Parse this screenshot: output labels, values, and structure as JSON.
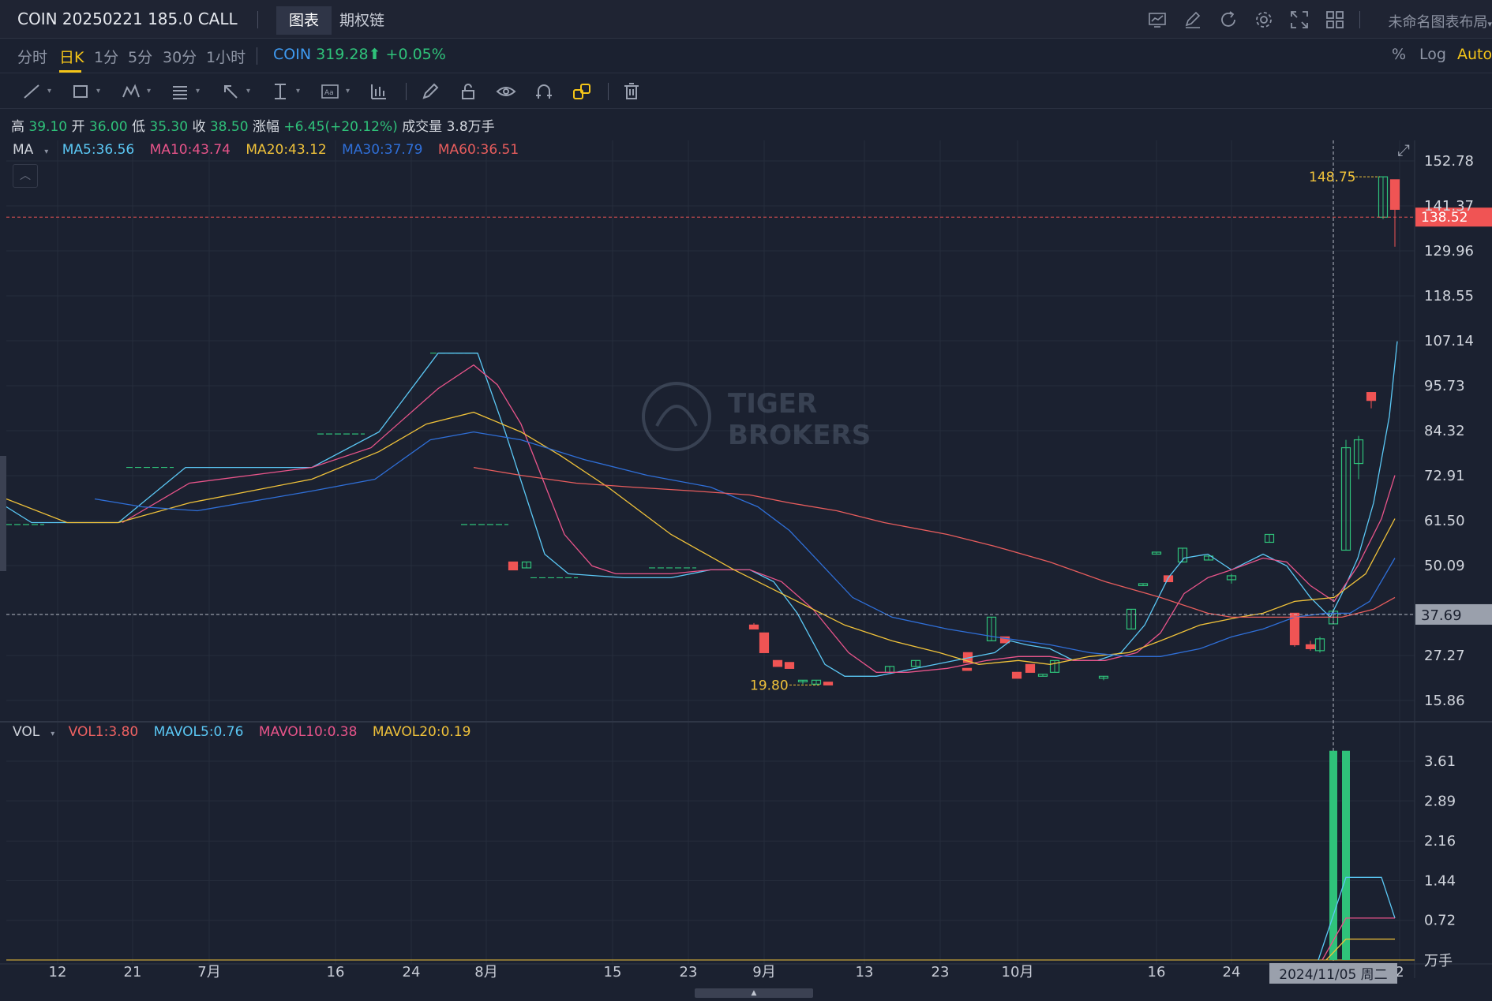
{
  "header": {
    "title": "COIN 20250221 185.0 CALL",
    "tabs": [
      {
        "label": "图表",
        "active": true
      },
      {
        "label": "期权链",
        "active": false
      }
    ],
    "layout_name": "未命名图表布局",
    "icons": [
      "chart-icon",
      "edit-icon",
      "refresh-icon",
      "settings-icon",
      "fullscreen-icon",
      "grid-layout-icon"
    ]
  },
  "periods": [
    "分时",
    "日K",
    "1分",
    "5分",
    "30分",
    "1小时"
  ],
  "active_period": "日K",
  "underlying": {
    "symbol": "COIN",
    "price": "319.28",
    "arrow": "⬆",
    "change": "+0.05%"
  },
  "scale_options": [
    "%",
    "Log",
    "Auto"
  ],
  "toolbar_tools": [
    "trend-line",
    "rectangle",
    "pattern",
    "fib",
    "arrow",
    "measure",
    "text",
    "indicator",
    "pencil",
    "lock",
    "eye",
    "magnet",
    "link",
    "trash"
  ],
  "ohlc": {
    "high_label": "高",
    "high": "39.10",
    "open_label": "开",
    "open": "36.00",
    "low_label": "低",
    "low": "35.30",
    "close_label": "收",
    "close": "38.50",
    "change_label": "涨幅",
    "change": "+6.45(+20.12%)",
    "volume_label": "成交量",
    "volume": "3.8万手"
  },
  "ma_legend": {
    "label": "MA",
    "items": [
      {
        "text": "MA5:36.56",
        "color": "#5bc8f5"
      },
      {
        "text": "MA10:43.74",
        "color": "#e8548a"
      },
      {
        "text": "MA20:43.12",
        "color": "#f0c23a"
      },
      {
        "text": "MA30:37.79",
        "color": "#2f6fd8"
      },
      {
        "text": "MA60:36.51",
        "color": "#e85d5d"
      }
    ]
  },
  "vol_legend": {
    "label": "VOL",
    "items": [
      {
        "text": "VOL1:3.80",
        "color": "#f06262"
      },
      {
        "text": "MAVOL5:0.76",
        "color": "#5bc8f5"
      },
      {
        "text": "MAVOL10:0.38",
        "color": "#e8548a"
      },
      {
        "text": "MAVOL20:0.19",
        "color": "#f0c23a"
      }
    ]
  },
  "colors": {
    "up": "#f05454",
    "down": "#2fc27a",
    "grid": "#2a3142",
    "bg": "#1b2130"
  },
  "chart_data": {
    "type": "candlestick",
    "price_axis": [
      "152.78",
      "141.37",
      "129.96",
      "118.55",
      "107.14",
      "95.73",
      "84.32",
      "72.91",
      "61.50",
      "50.09",
      "37.69",
      "27.27",
      "15.86"
    ],
    "price_ylim": [
      15.86,
      152.78
    ],
    "current_price_tag": "138.52",
    "crosshair_price_tag": "37.69",
    "max_label": "148.75",
    "min_label": "19.80",
    "x_ticks": [
      "12",
      "21",
      "7月",
      "16",
      "24",
      "8月",
      "15",
      "23",
      "9月",
      "13",
      "23",
      "10月",
      "16",
      "24",
      "2"
    ],
    "crosshair_date": "2024/11/05 周二",
    "candles": [
      {
        "o": 60.5,
        "c": 60.5,
        "h": 60.5,
        "l": 60.5
      },
      {
        "o": 75.0,
        "c": 75.0,
        "h": 75.0,
        "l": 75.0
      },
      {
        "o": 83.5,
        "c": 83.5,
        "h": 83.5,
        "l": 83.5
      },
      {
        "o": 104.0,
        "c": 104.0,
        "h": 104.0,
        "l": 104.0
      },
      {
        "o": 60.5,
        "c": 60.5,
        "h": 60.5,
        "l": 60.5
      },
      {
        "o": 51.0,
        "c": 49.0,
        "h": 51.0,
        "l": 49.0
      },
      {
        "o": 49.5,
        "c": 51.0,
        "h": 51.0,
        "l": 49.5
      },
      {
        "o": 47.0,
        "c": 47.0,
        "h": 47.0,
        "l": 47.0
      },
      {
        "o": 49.5,
        "c": 49.5,
        "h": 49.5,
        "l": 49.5
      },
      {
        "o": 35.0,
        "c": 34.0,
        "h": 35.5,
        "l": 34.0
      },
      {
        "o": 33.0,
        "c": 28.0,
        "h": 33.0,
        "l": 28.0
      },
      {
        "o": 26.0,
        "c": 24.5,
        "h": 26.0,
        "l": 24.5
      },
      {
        "o": 25.5,
        "c": 24.0,
        "h": 25.5,
        "l": 24.0
      },
      {
        "o": 21.0,
        "c": 21.0,
        "h": 21.0,
        "l": 20.0
      },
      {
        "o": 20.0,
        "c": 21.0,
        "h": 21.0,
        "l": 19.8
      },
      {
        "o": 20.5,
        "c": 19.8,
        "h": 20.5,
        "l": 19.8
      },
      {
        "o": 23.0,
        "c": 24.5,
        "h": 24.5,
        "l": 23.0
      },
      {
        "o": 24.5,
        "c": 26.0,
        "h": 26.0,
        "l": 24.5
      },
      {
        "o": 28.0,
        "c": 25.5,
        "h": 28.0,
        "l": 25.5
      },
      {
        "o": 24.0,
        "c": 23.5,
        "h": 24.0,
        "l": 23.5
      },
      {
        "o": 31.0,
        "c": 37.0,
        "h": 37.0,
        "l": 31.0
      },
      {
        "o": 32.0,
        "c": 30.5,
        "h": 32.0,
        "l": 30.5
      },
      {
        "o": 23.0,
        "c": 21.5,
        "h": 23.0,
        "l": 21.5
      },
      {
        "o": 25.0,
        "c": 23.0,
        "h": 25.0,
        "l": 23.0
      },
      {
        "o": 22.0,
        "c": 22.5,
        "h": 22.5,
        "l": 22.0
      },
      {
        "o": 23.0,
        "c": 26.0,
        "h": 26.0,
        "l": 23.0
      },
      {
        "o": 21.5,
        "c": 22.0,
        "h": 22.0,
        "l": 21.0
      },
      {
        "o": 34.0,
        "c": 39.0,
        "h": 39.0,
        "l": 34.0
      },
      {
        "o": 45.0,
        "c": 45.5,
        "h": 45.5,
        "l": 45.0
      },
      {
        "o": 53.0,
        "c": 53.5,
        "h": 53.5,
        "l": 53.0
      },
      {
        "o": 47.5,
        "c": 46.0,
        "h": 47.5,
        "l": 46.0
      },
      {
        "o": 51.0,
        "c": 54.5,
        "h": 54.5,
        "l": 51.0
      },
      {
        "o": 51.5,
        "c": 52.5,
        "h": 52.5,
        "l": 51.5
      },
      {
        "o": 46.5,
        "c": 47.5,
        "h": 48.0,
        "l": 45.5
      },
      {
        "o": 56.0,
        "c": 58.0,
        "h": 58.0,
        "l": 56.0
      },
      {
        "o": 38.0,
        "c": 30.0,
        "h": 38.0,
        "l": 29.5
      },
      {
        "o": 30.0,
        "c": 29.0,
        "h": 31.0,
        "l": 28.5
      },
      {
        "o": 28.5,
        "c": 31.5,
        "h": 32.0,
        "l": 28.0
      },
      {
        "o": 35.3,
        "c": 38.5,
        "h": 39.1,
        "l": 35.3
      },
      {
        "o": 54.0,
        "c": 80.0,
        "h": 82.0,
        "l": 54.0
      },
      {
        "o": 76.0,
        "c": 82.0,
        "h": 83.0,
        "l": 72.0
      },
      {
        "o": 94.0,
        "c": 92.0,
        "h": 94.0,
        "l": 90.0
      },
      {
        "o": 138.5,
        "c": 148.75,
        "h": 148.75,
        "l": 138.0
      },
      {
        "o": 148.0,
        "c": 140.5,
        "h": 148.0,
        "l": 131.0
      }
    ],
    "ma_series": [
      {
        "name": "MA5",
        "values": [
          [
            0,
            66
          ],
          [
            40,
            61
          ],
          [
            115,
            61
          ],
          [
            150,
            61
          ],
          [
            235,
            75
          ],
          [
            395,
            75
          ],
          [
            480,
            84
          ],
          [
            555,
            104
          ],
          [
            605,
            104
          ],
          [
            640,
            84
          ],
          [
            690,
            53
          ],
          [
            720,
            48
          ],
          [
            790,
            47
          ],
          [
            850,
            47
          ],
          [
            900,
            49
          ],
          [
            950,
            49
          ],
          [
            980,
            46
          ],
          [
            1010,
            38
          ],
          [
            1045,
            25
          ],
          [
            1070,
            22
          ],
          [
            1110,
            22
          ],
          [
            1160,
            24
          ],
          [
            1210,
            26
          ],
          [
            1260,
            28
          ],
          [
            1280,
            31
          ],
          [
            1300,
            30
          ],
          [
            1330,
            29
          ],
          [
            1360,
            26
          ],
          [
            1390,
            26
          ],
          [
            1420,
            28
          ],
          [
            1450,
            35
          ],
          [
            1480,
            47
          ],
          [
            1500,
            52
          ],
          [
            1530,
            53
          ],
          [
            1560,
            49
          ],
          [
            1600,
            53
          ],
          [
            1630,
            50
          ],
          [
            1660,
            42
          ],
          [
            1685,
            37
          ],
          [
            1700,
            43
          ],
          [
            1720,
            52
          ],
          [
            1740,
            66
          ],
          [
            1760,
            88
          ],
          [
            1770,
            107
          ]
        ]
      },
      {
        "name": "MA10",
        "values": [
          [
            155,
            61
          ],
          [
            240,
            71
          ],
          [
            395,
            75
          ],
          [
            470,
            80
          ],
          [
            555,
            95
          ],
          [
            600,
            101
          ],
          [
            630,
            96
          ],
          [
            660,
            86
          ],
          [
            715,
            58
          ],
          [
            750,
            50
          ],
          [
            780,
            48
          ],
          [
            850,
            48
          ],
          [
            900,
            49
          ],
          [
            950,
            49
          ],
          [
            990,
            46
          ],
          [
            1030,
            39
          ],
          [
            1075,
            28
          ],
          [
            1110,
            23
          ],
          [
            1150,
            23
          ],
          [
            1200,
            24
          ],
          [
            1250,
            26
          ],
          [
            1290,
            27
          ],
          [
            1330,
            27
          ],
          [
            1360,
            26
          ],
          [
            1400,
            26
          ],
          [
            1440,
            28
          ],
          [
            1470,
            33
          ],
          [
            1500,
            43
          ],
          [
            1530,
            47
          ],
          [
            1560,
            49
          ],
          [
            1600,
            52
          ],
          [
            1630,
            51
          ],
          [
            1660,
            45
          ],
          [
            1690,
            41
          ],
          [
            1720,
            50
          ],
          [
            1750,
            62
          ],
          [
            1767,
            73
          ]
        ]
      },
      {
        "name": "MA20",
        "values": [
          [
            8,
            67
          ],
          [
            85,
            61
          ],
          [
            150,
            61
          ],
          [
            240,
            66
          ],
          [
            395,
            72
          ],
          [
            480,
            79
          ],
          [
            540,
            86
          ],
          [
            600,
            89
          ],
          [
            660,
            84
          ],
          [
            710,
            78
          ],
          [
            770,
            70
          ],
          [
            850,
            58
          ],
          [
            930,
            49
          ],
          [
            1000,
            42
          ],
          [
            1070,
            35
          ],
          [
            1130,
            31
          ],
          [
            1190,
            28
          ],
          [
            1240,
            25
          ],
          [
            1290,
            26
          ],
          [
            1330,
            25
          ],
          [
            1380,
            27
          ],
          [
            1430,
            28
          ],
          [
            1470,
            31
          ],
          [
            1520,
            35
          ],
          [
            1570,
            37
          ],
          [
            1600,
            38
          ],
          [
            1640,
            41
          ],
          [
            1690,
            42
          ],
          [
            1730,
            48
          ],
          [
            1767,
            62
          ]
        ]
      },
      {
        "name": "MA30",
        "values": [
          [
            120,
            67
          ],
          [
            150,
            66
          ],
          [
            180,
            65
          ],
          [
            250,
            64
          ],
          [
            395,
            69
          ],
          [
            475,
            72
          ],
          [
            545,
            82
          ],
          [
            600,
            84
          ],
          [
            660,
            82
          ],
          [
            740,
            77
          ],
          [
            820,
            73
          ],
          [
            900,
            70
          ],
          [
            960,
            65
          ],
          [
            1000,
            59
          ],
          [
            1080,
            42
          ],
          [
            1130,
            37
          ],
          [
            1200,
            34
          ],
          [
            1260,
            32
          ],
          [
            1330,
            30
          ],
          [
            1380,
            28
          ],
          [
            1430,
            27
          ],
          [
            1470,
            27
          ],
          [
            1520,
            29
          ],
          [
            1560,
            32
          ],
          [
            1600,
            34
          ],
          [
            1640,
            37
          ],
          [
            1680,
            38
          ],
          [
            1710,
            38
          ],
          [
            1735,
            41
          ],
          [
            1767,
            52
          ]
        ]
      },
      {
        "name": "MA60",
        "values": [
          [
            600,
            75
          ],
          [
            660,
            73
          ],
          [
            730,
            71
          ],
          [
            800,
            70
          ],
          [
            880,
            69
          ],
          [
            950,
            68
          ],
          [
            1000,
            66
          ],
          [
            1060,
            64
          ],
          [
            1120,
            61
          ],
          [
            1200,
            58
          ],
          [
            1260,
            55
          ],
          [
            1330,
            51
          ],
          [
            1400,
            46
          ],
          [
            1470,
            42
          ],
          [
            1530,
            38
          ],
          [
            1560,
            37
          ],
          [
            1600,
            37
          ],
          [
            1650,
            37
          ],
          [
            1700,
            37
          ],
          [
            1740,
            39
          ],
          [
            1767,
            42
          ]
        ]
      }
    ],
    "vol_axis": [
      "3.61",
      "2.89",
      "2.16",
      "1.44",
      "0.72",
      "万手"
    ],
    "vol_ylim": [
      0,
      3.8
    ],
    "volumes": [
      {
        "x": 1689,
        "v": 3.8,
        "dir": "down"
      },
      {
        "x": 1705,
        "v": 3.8,
        "dir": "down"
      }
    ],
    "mavol_series": [
      {
        "name": "MAVOL5",
        "values": [
          [
            1670,
            0
          ],
          [
            1705,
            1.5
          ],
          [
            1750,
            1.5
          ],
          [
            1767,
            0.76
          ]
        ]
      },
      {
        "name": "MAVOL10",
        "values": [
          [
            1675,
            0
          ],
          [
            1705,
            0.76
          ],
          [
            1767,
            0.76
          ]
        ]
      },
      {
        "name": "MAVOL20",
        "values": [
          [
            1680,
            0
          ],
          [
            1705,
            0.38
          ],
          [
            1767,
            0.38
          ]
        ]
      }
    ]
  }
}
